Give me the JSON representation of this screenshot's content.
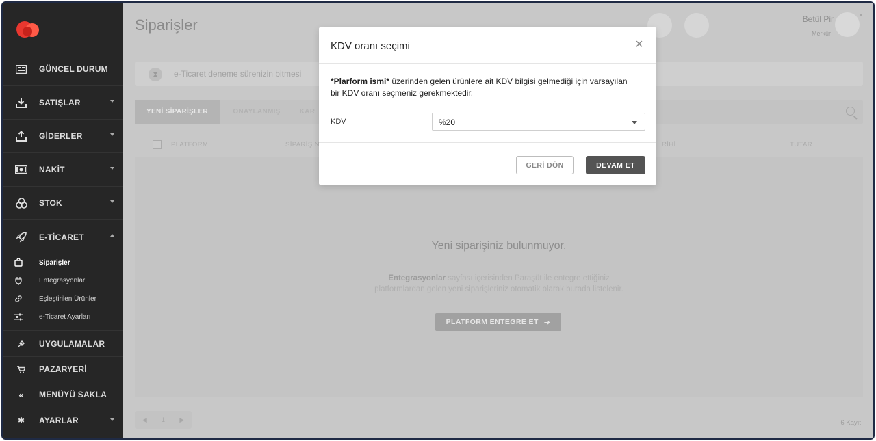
{
  "sidebar": {
    "items": [
      {
        "label": "GÜNCEL DURUM",
        "icon": "dashboard-icon"
      },
      {
        "label": "SATIŞLAR",
        "icon": "download-icon"
      },
      {
        "label": "GİDERLER",
        "icon": "upload-icon"
      },
      {
        "label": "NAKİT",
        "icon": "banknote-icon"
      },
      {
        "label": "STOK",
        "icon": "boxes-icon"
      },
      {
        "label": "E-TİCARET",
        "icon": "rocket-icon"
      }
    ],
    "sub_items": [
      {
        "label": "Siparişler",
        "icon": "shopping-bag-icon"
      },
      {
        "label": "Entegrasyonlar",
        "icon": "plug-icon"
      },
      {
        "label": "Eşleştirilen Ürünler",
        "icon": "link-icon"
      },
      {
        "label": "e-Ticaret Ayarları",
        "icon": "sliders-icon"
      }
    ],
    "bottom_items": [
      {
        "label": "UYGULAMALAR",
        "icon": "plug-icon"
      },
      {
        "label": "PAZARYERİ",
        "icon": "cart-icon"
      },
      {
        "label": "MENÜYÜ SAKLA",
        "icon": "double-chevron-left-icon"
      },
      {
        "label": "AYARLAR",
        "icon": "gear-icon"
      }
    ]
  },
  "header": {
    "title": "Siparişler",
    "user_name": "Betül Pir",
    "user_sub": "Merkür"
  },
  "notice": {
    "text": "e-Ticaret deneme sürenizin bitmesi"
  },
  "tabs": [
    "YENİ SİPARİŞLER",
    "ONAYLANMIŞ",
    "KAR"
  ],
  "table": {
    "headers": [
      "PLATFORM",
      "SİPARİŞ N",
      "RİHİ",
      "TUTAR"
    ]
  },
  "empty_state": {
    "title": "Yeni siparişiniz bulunmuyor.",
    "desc_bold": "Entegrasyonlar",
    "desc_line1_rest": " sayfası içerisinden Paraşüt ile entegre ettiğiniz",
    "desc_line2": "platformlardan gelen yeni siparişleriniz otomatik olarak burada listelenir.",
    "button": "PLATFORM ENTEGRE ET"
  },
  "pager": {
    "page": "1"
  },
  "records": "6 Kayıt",
  "modal": {
    "title": "KDV oranı seçimi",
    "msg_bold": "*Plarform ismi*",
    "msg_rest": " üzerinden gelen ürünlere ait KDV bilgisi gelmediği için varsayılan bir KDV oranı seçmeniz gerekmektedir.",
    "kdv_label": "KDV",
    "kdv_value": "%20",
    "back_label": "GERİ DÖN",
    "next_label": "DEVAM ET"
  },
  "colors": {
    "sidebar_bg": "#262626",
    "brand_red": "#e8372f",
    "primary_button": "#545454"
  }
}
